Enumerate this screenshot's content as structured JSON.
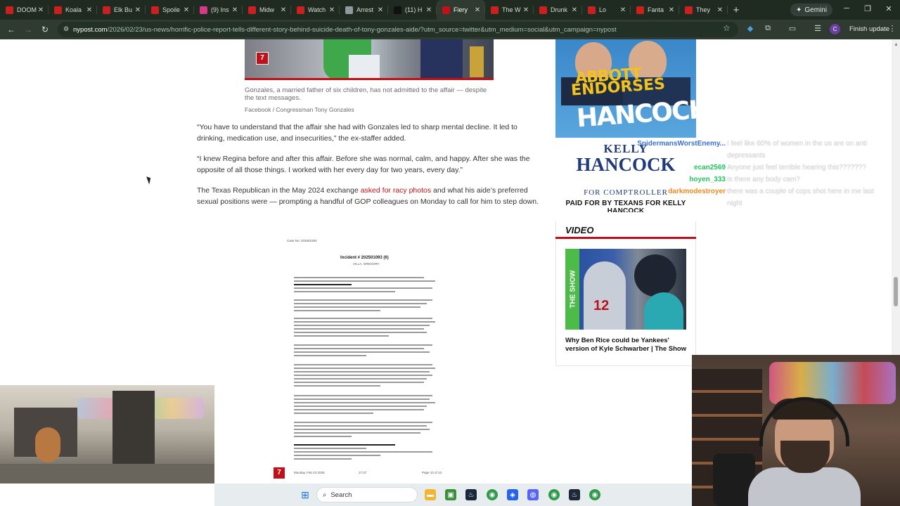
{
  "browser": {
    "tabs": [
      {
        "label": "DOOM",
        "color": "#cc1f1f",
        "icon": "youtube-icon"
      },
      {
        "label": "Koala",
        "color": "#cc1f1f",
        "icon": "youtube-icon"
      },
      {
        "label": "Elk Bu",
        "color": "#cc1f1f",
        "icon": "youtube-icon"
      },
      {
        "label": "Spoile",
        "color": "#cc1f1f",
        "icon": "youtube-icon"
      },
      {
        "label": "(9) Ins",
        "color": "#d63a84",
        "icon": "instagram-icon"
      },
      {
        "label": "Midw",
        "color": "#cc1f1f",
        "icon": "youtube-icon"
      },
      {
        "label": "Watch",
        "color": "#cc1f1f",
        "icon": "youtube-icon"
      },
      {
        "label": "Arrest",
        "color": "#8e9aa0",
        "icon": "globe-icon"
      },
      {
        "label": "(11) H",
        "color": "#111111",
        "icon": "x-icon"
      },
      {
        "label": "Fiery",
        "color": "#c0111a",
        "icon": "nypost-icon",
        "active": true
      },
      {
        "label": "The W",
        "color": "#cc1f1f",
        "icon": "youtube-icon"
      },
      {
        "label": "Drunk",
        "color": "#cc1f1f",
        "icon": "youtube-icon"
      },
      {
        "label": "Lo",
        "color": "#cc1f1f",
        "icon": "youtube-icon"
      },
      {
        "label": "Fanta",
        "color": "#cc1f1f",
        "icon": "youtube-icon"
      },
      {
        "label": "They",
        "color": "#cc1f1f",
        "icon": "youtube-icon"
      }
    ],
    "new_tab": "+",
    "gemini_label": "Gemini",
    "url_domain": "nypost.com",
    "url_path": "/2026/02/23/us-news/horrific-police-report-tells-different-story-behind-suicide-death-of-tony-gonzales-aide/?utm_source=twitter&utm_medium=social&utm_campaign=nypost",
    "profile_initial": "C",
    "finish_update": "Finish update"
  },
  "article": {
    "badge": "7",
    "caption": "Gonzales, a married father of six children, has not admitted to the affair — despite the text messages.",
    "credit": "Facebook / Congressman Tony Gonzales",
    "para1": "“You have to understand that the affair she had with Gonzales led to sharp mental decline. It led to drinking, medication use, and insecurities,” the ex-staffer added.",
    "para2": "“I knew Regina before and after this affair. Before she was normal, calm, and happy. After she was the opposite of all those things. I worked with her every day for two years, every day.”",
    "para3_before": "The Texas Republican in the May 2024 exchange ",
    "para3_link": "asked for racy photos",
    "para3_after": " and what his aide’s preferred sexual positions were — prompting a handful of GOP colleagues on Monday to call for him to step down.",
    "doc": {
      "case_no": "Case No: 202501093",
      "title": "Incident # 202501093 (6)",
      "officer": "VILLA, GREGORY",
      "footer_left": "Monday, Feb 23 2026",
      "footer_mid": "17:37",
      "footer_right": "Page 10 of 13"
    }
  },
  "ad": {
    "line1": "ABBOTT",
    "line2": "ENDORSES",
    "line3": "HANCOCK",
    "kelly": "KELLY",
    "hancock": "HANCOCK",
    "for": "FOR COMPTROLLER",
    "paid": "PAID FOR BY TEXANS FOR KELLY HANCOCK"
  },
  "video": {
    "heading": "VIDEO",
    "strip_text": "THE SHOW",
    "jersey_number": "12",
    "title": "Why Ben Rice could be Yankees' version of Kyle Schwarber | The Show"
  },
  "chat": [
    {
      "user": "SpidermansWorstEnemy...",
      "color": "#3b6fd6",
      "msg": "I feel like 60% of women in the us are on anti"
    },
    {
      "user": "",
      "color": "#ffffff",
      "msg": "depressants"
    },
    {
      "user": "ecan2569",
      "color": "#22c55e",
      "msg": "Anyone just feel terrible hearing this???????"
    },
    {
      "user": "hoyen_333",
      "color": "#22c55e",
      "msg": "Is there any body cam?"
    },
    {
      "user": "darkmodestroyer",
      "color": "#ef8a1f",
      "msg": "there was a couple of cops shot here in me last"
    },
    {
      "user": "",
      "color": "#ffffff",
      "msg": "night"
    }
  ],
  "taskbar": {
    "search_label": "Search"
  }
}
